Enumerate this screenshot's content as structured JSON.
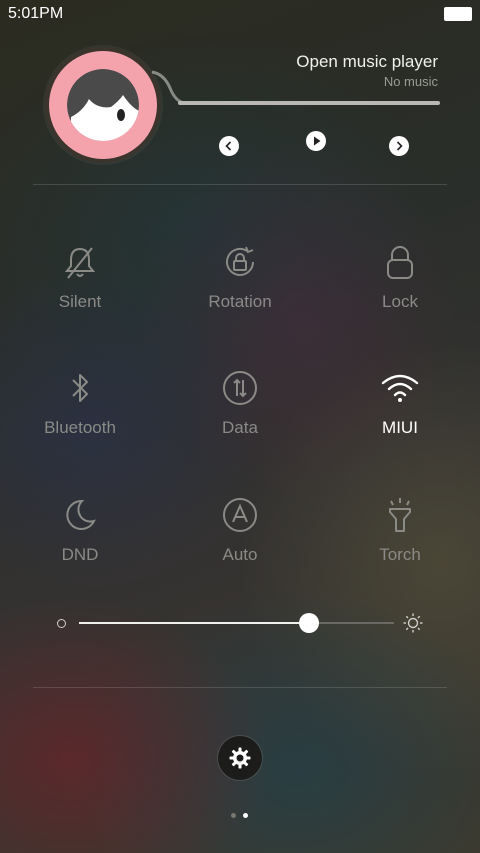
{
  "status_bar": {
    "time": "5:01PM"
  },
  "music": {
    "title": "Open music player",
    "subtitle": "No music",
    "progress": 0.0
  },
  "toggles": [
    {
      "label": "Silent",
      "icon": "bell-off-icon",
      "active": false
    },
    {
      "label": "Rotation",
      "icon": "rotation-lock-icon",
      "active": false
    },
    {
      "label": "Lock",
      "icon": "lock-icon",
      "active": false
    },
    {
      "label": "Bluetooth",
      "icon": "bluetooth-icon",
      "active": false
    },
    {
      "label": "Data",
      "icon": "mobile-data-icon",
      "active": false
    },
    {
      "label": "MIUI",
      "icon": "wifi-icon",
      "active": true
    },
    {
      "label": "DND",
      "icon": "moon-icon",
      "active": false
    },
    {
      "label": "Auto",
      "icon": "auto-brightness-icon",
      "active": false
    },
    {
      "label": "Torch",
      "icon": "flashlight-icon",
      "active": false
    }
  ],
  "brightness": {
    "level": 0.73
  },
  "pager": {
    "pages": 2,
    "current": 2
  },
  "colors": {
    "album_bg": "#f4a3ad",
    "active_label": "#ffffff",
    "inactive_label": "#8a8a86"
  }
}
